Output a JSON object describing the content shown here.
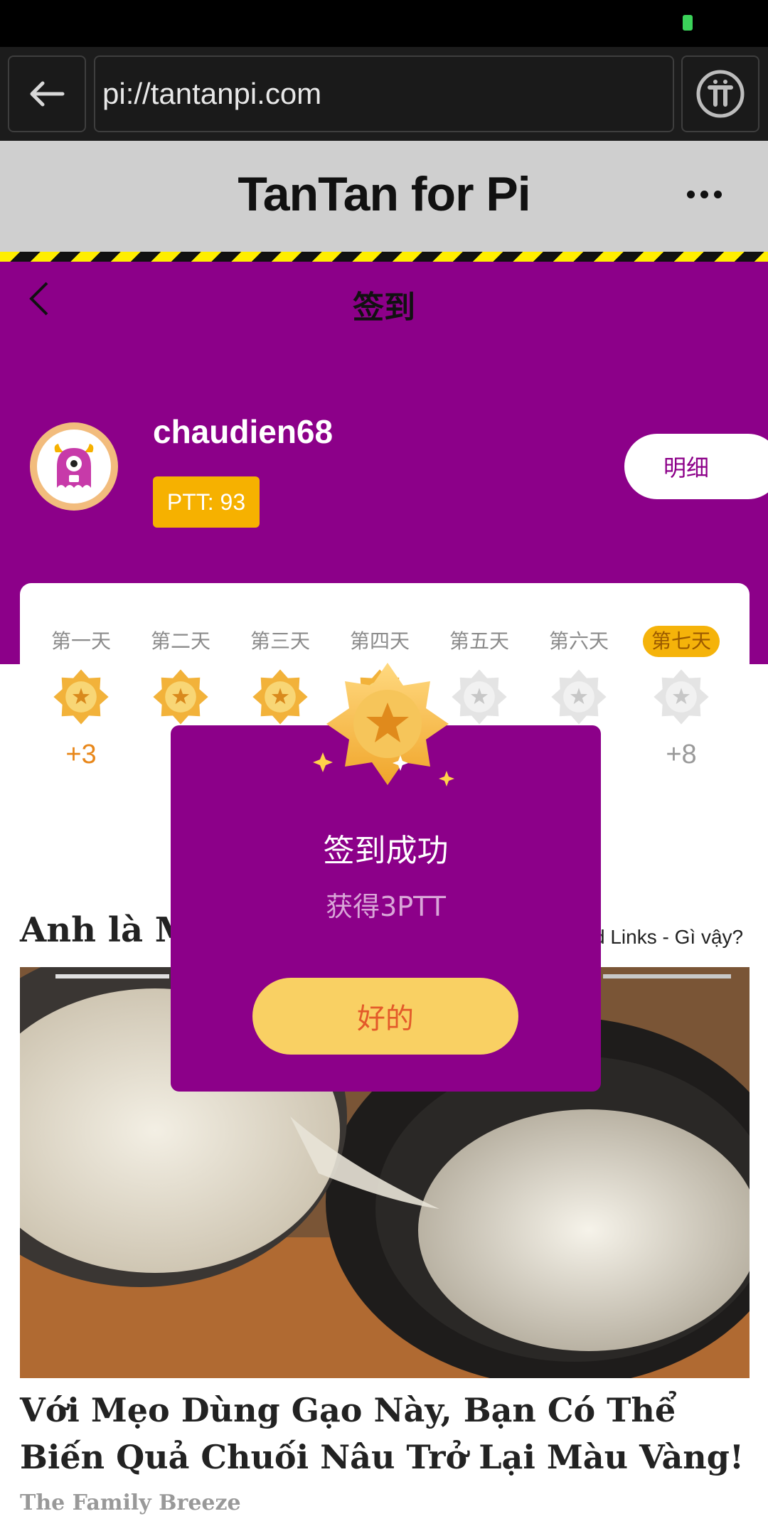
{
  "browser": {
    "url": "pi://tantanpi.com"
  },
  "app": {
    "title": "TanTan for Pi"
  },
  "page": {
    "title": "签到"
  },
  "profile": {
    "username": "chaudien68",
    "ptt_badge": "PTT: 93",
    "detail_button": "明细"
  },
  "checkin": {
    "days": [
      {
        "label": "第一天",
        "reward": "+3",
        "checked": true
      },
      {
        "label": "第二天",
        "reward": "",
        "checked": true
      },
      {
        "label": "第三天",
        "reward": "",
        "checked": true
      },
      {
        "label": "第四天",
        "reward": "",
        "checked": true
      },
      {
        "label": "第五天",
        "reward": "",
        "checked": false
      },
      {
        "label": "第六天",
        "reward": "",
        "checked": false
      },
      {
        "label": "第七天",
        "reward": "+8",
        "checked": false,
        "current": true
      }
    ]
  },
  "article": {
    "heading": "Anh là M",
    "source_link": "d Links - Gì vậy?",
    "photo_title": "Với Mẹo Dùng Gạo Này, Bạn Có Thể Biến Quả Chuối Nâu Trở Lại Màu Vàng!",
    "photo_source": "The Family Breeze"
  },
  "modal": {
    "title": "签到成功",
    "subtitle": "获得3PTT",
    "ok_button": "好的"
  },
  "colors": {
    "purple": "#8c0089",
    "gold": "#f6b100",
    "button_yellow": "#f9d063",
    "button_text": "#e35a2a"
  }
}
